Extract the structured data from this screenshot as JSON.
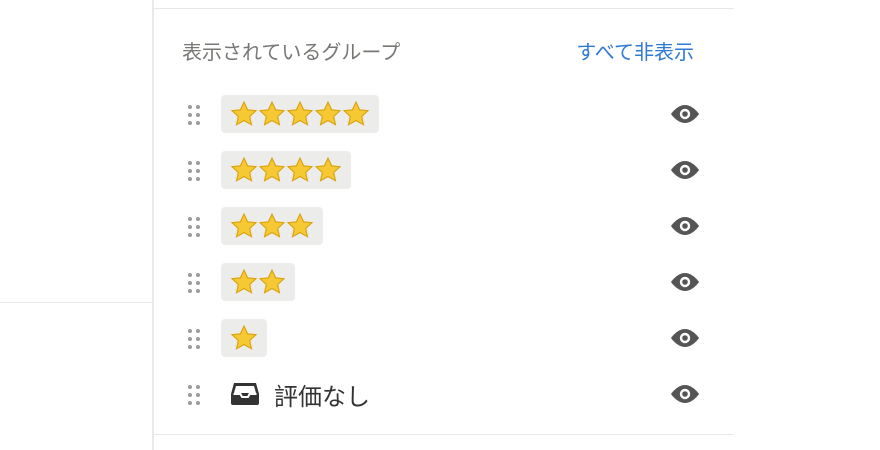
{
  "panel": {
    "title": "表示されているグループ",
    "hide_all_label": "すべて非表示"
  },
  "colors": {
    "accent": "#2f7ad6",
    "muted_text": "#787774",
    "pill_bg": "#ececeb",
    "star": "#f4c430",
    "icon": "#555555"
  },
  "groups": [
    {
      "stars": 5,
      "label": "⭐⭐⭐⭐⭐",
      "visible": true,
      "icon": "star-icon"
    },
    {
      "stars": 4,
      "label": "⭐⭐⭐⭐",
      "visible": true,
      "icon": "star-icon"
    },
    {
      "stars": 3,
      "label": "⭐⭐⭐",
      "visible": true,
      "icon": "star-icon"
    },
    {
      "stars": 2,
      "label": "⭐⭐",
      "visible": true,
      "icon": "star-icon"
    },
    {
      "stars": 1,
      "label": "⭐",
      "visible": true,
      "icon": "star-icon"
    },
    {
      "stars": 0,
      "label": "評価なし",
      "visible": true,
      "icon": "inbox-icon"
    }
  ]
}
